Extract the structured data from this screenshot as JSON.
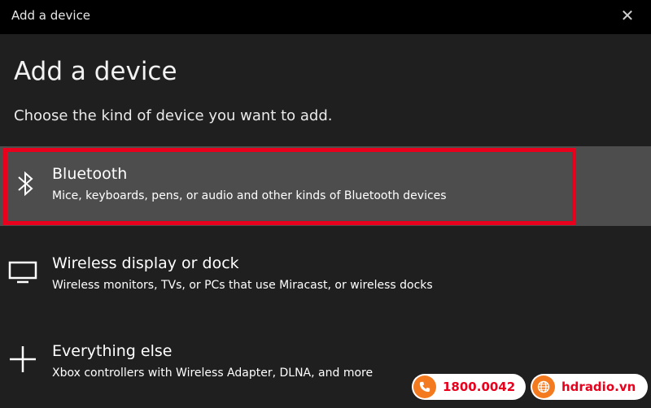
{
  "window": {
    "title": "Add a device",
    "close_glyph": "✕"
  },
  "page": {
    "heading": "Add a device",
    "subheading": "Choose the kind of device you want to add."
  },
  "options": [
    {
      "name": "Bluetooth",
      "description": "Mice, keyboards, pens, or audio and other kinds of Bluetooth devices",
      "icon": "bluetooth-icon",
      "selected": true
    },
    {
      "name": "Wireless display or dock",
      "description": "Wireless monitors, TVs, or PCs that use Miracast, or wireless docks",
      "icon": "monitor-icon",
      "selected": false
    },
    {
      "name": "Everything else",
      "description": "Xbox controllers with Wireless Adapter, DLNA, and more",
      "icon": "plus-icon",
      "selected": false
    }
  ],
  "watermark": {
    "phone": "1800.0042",
    "site": "hdradio.vn",
    "phone_icon": "phone-icon",
    "site_icon": "globe-icon"
  },
  "colors": {
    "background": "#1f1f1f",
    "titlebar": "#000000",
    "selected_row": "#4d4d4d",
    "highlight_border": "#e8001c",
    "badge_accent": "#f47a20"
  }
}
